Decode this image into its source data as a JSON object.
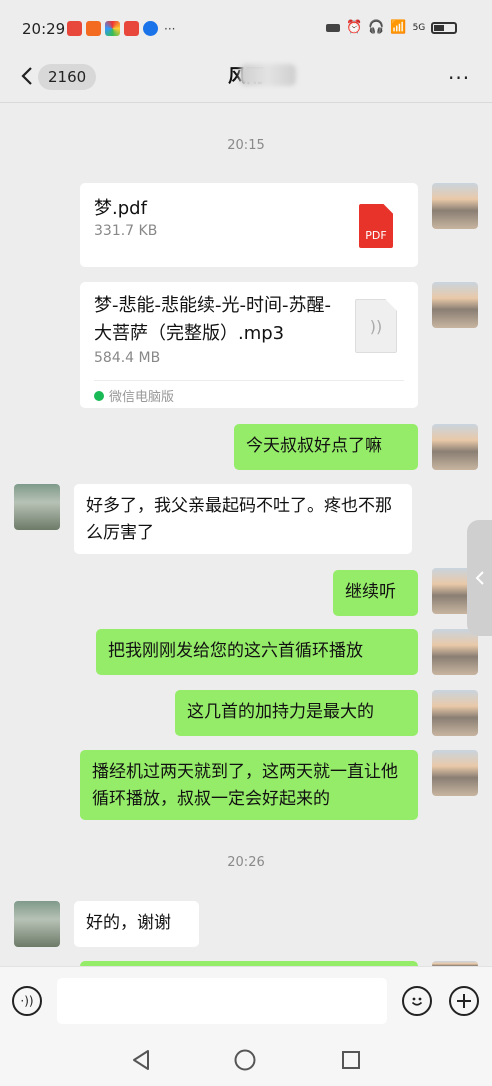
{
  "status_bar": {
    "time": "20:29",
    "dots": "···",
    "network": "5G"
  },
  "header": {
    "unread_count": "2160",
    "title": "风雨",
    "more": "···"
  },
  "timestamps": [
    "20:15",
    "20:26"
  ],
  "messages": [
    {
      "type": "file",
      "from": "self",
      "name": "梦.pdf",
      "size": "331.7 KB",
      "icon": "pdf-icon",
      "icon_label": "PDF"
    },
    {
      "type": "file",
      "from": "self",
      "name": "梦-悲能-悲能续-光-时间-苏醒-大菩萨（完整版）.mp3",
      "size": "584.4 MB",
      "icon": "audio-file-icon",
      "source": "微信电脑版"
    },
    {
      "type": "text",
      "from": "self",
      "text": "今天叔叔好点了嘛"
    },
    {
      "type": "text",
      "from": "other",
      "text": "好多了，我父亲最起码不吐了。疼也不那么厉害了"
    },
    {
      "type": "text",
      "from": "self",
      "text": "继续听"
    },
    {
      "type": "text",
      "from": "self",
      "text": "把我刚刚发给您的这六首循环播放"
    },
    {
      "type": "text",
      "from": "self",
      "text": "这几首的加持力是最大的"
    },
    {
      "type": "text",
      "from": "self",
      "text": "播经机过两天就到了，这两天就一直让他循环播放，叔叔一定会好起来的"
    },
    {
      "type": "text",
      "from": "other",
      "text": "好的，谢谢"
    }
  ],
  "input_bar": {
    "placeholder": ""
  },
  "colors": {
    "self_bubble": "#95ec69",
    "other_bubble": "#ffffff",
    "background": "#ededed"
  }
}
